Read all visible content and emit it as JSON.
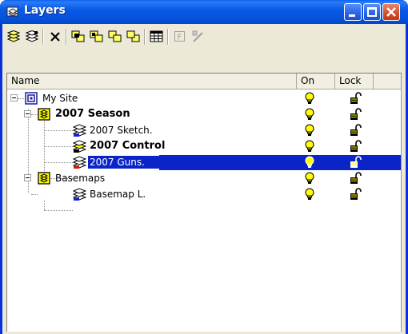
{
  "window": {
    "title": "Layers"
  },
  "toolbar": {
    "buttons": [
      {
        "name": "new-layer-icon"
      },
      {
        "name": "new-sublayer-icon"
      },
      {
        "name": "delete-icon"
      },
      {
        "name": "bring-to-front-icon"
      },
      {
        "name": "send-to-back-icon"
      },
      {
        "name": "move-up-icon"
      },
      {
        "name": "move-down-icon"
      },
      {
        "name": "attribute-table-icon"
      },
      {
        "name": "filter-icon"
      },
      {
        "name": "line-tool-icon"
      }
    ]
  },
  "columns": {
    "name": "Name",
    "on": "On",
    "lock": "Lock"
  },
  "tree": {
    "rows": [
      {
        "label": "My Site",
        "bold": false,
        "selected": false,
        "icon": "site-icon"
      },
      {
        "label": "2007 Season",
        "bold": true,
        "selected": false,
        "icon": "folder-layer-icon"
      },
      {
        "label": "2007 Sketch.",
        "bold": false,
        "selected": false,
        "icon": "sketch-layer-icon"
      },
      {
        "label": "2007 Control",
        "bold": true,
        "selected": false,
        "icon": "control-layer-icon"
      },
      {
        "label": "2007 Guns.",
        "bold": false,
        "selected": true,
        "icon": "guns-layer-icon"
      },
      {
        "label": "Basemaps",
        "bold": false,
        "selected": false,
        "icon": "folder-layer-icon"
      },
      {
        "label": "Basemap L.",
        "bold": false,
        "selected": false,
        "icon": "basemap-layer-icon"
      }
    ]
  },
  "colors": {
    "titlebar": "#0a5ae6",
    "selection": "#0a24c8",
    "bulb": "#ffff00",
    "lock": "#000000"
  }
}
